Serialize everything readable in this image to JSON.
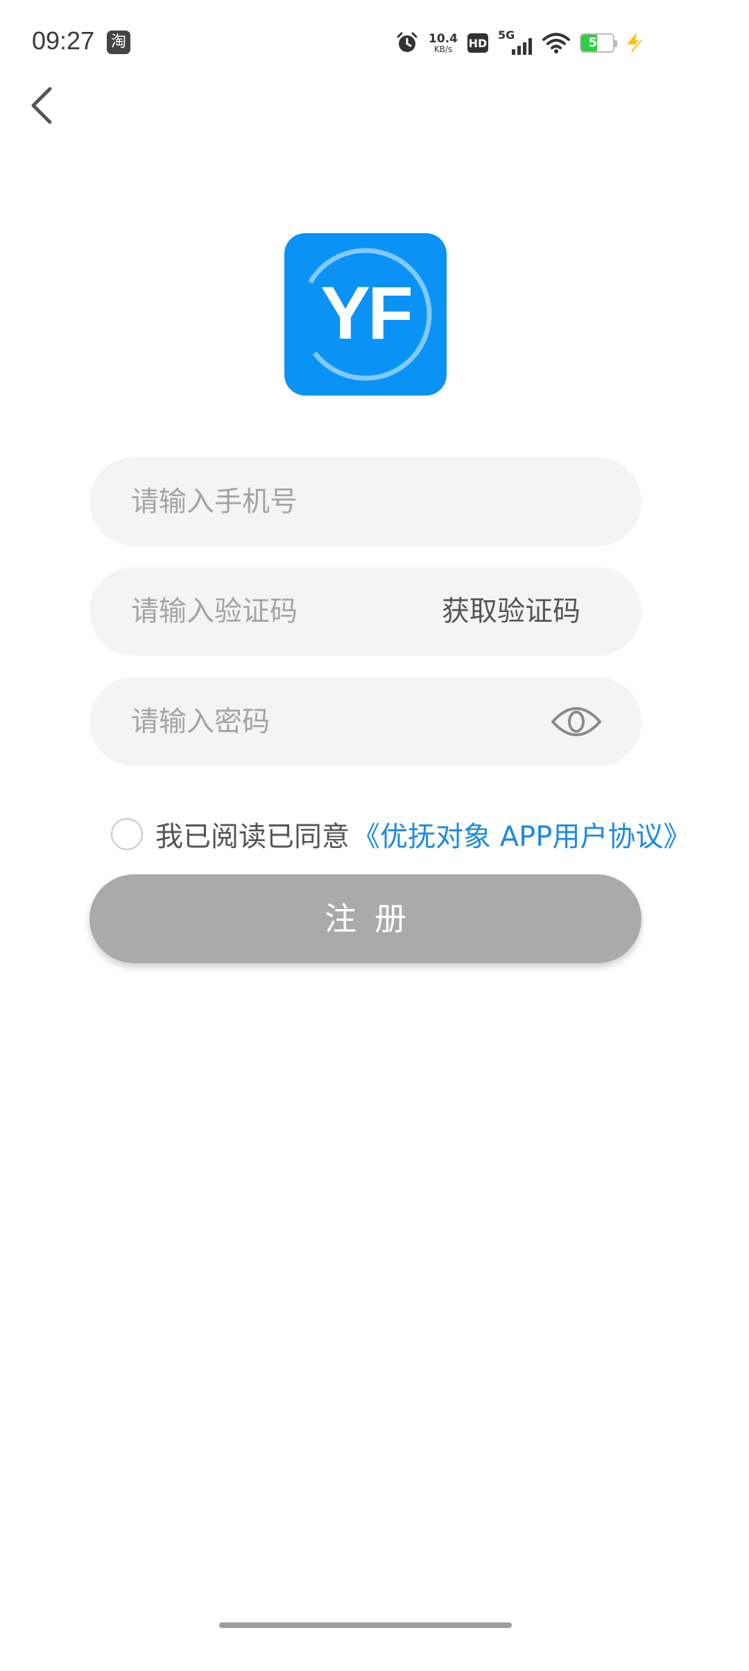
{
  "status_bar": {
    "time": "09:27",
    "notification_icon": "taobao-icon",
    "notification_glyph": "淘",
    "net_speed_value": "10.4",
    "net_speed_unit": "KB/s",
    "hd_label": "HD",
    "network_label": "5G",
    "battery_level": "51",
    "battery_fraction": 0.51,
    "battery_color": "#2fcf41"
  },
  "icons": {
    "back": "chevron-left-icon",
    "eye": "eye-icon",
    "alarm": "alarm-icon",
    "wifi": "wifi-icon",
    "charging": "lightning-icon"
  },
  "logo": {
    "text": "YF",
    "color": "#0a93f5"
  },
  "form": {
    "phone_placeholder": "请输入手机号",
    "code_placeholder": "请输入验证码",
    "get_code_label": "获取验证码",
    "password_placeholder": "请输入密码"
  },
  "agreement": {
    "text": "我已阅读已同意",
    "link": "《优抚对象 APP用户协议》",
    "link_color": "#1a8ae6"
  },
  "register": {
    "label": "注册",
    "color": "#aaaaaa"
  }
}
